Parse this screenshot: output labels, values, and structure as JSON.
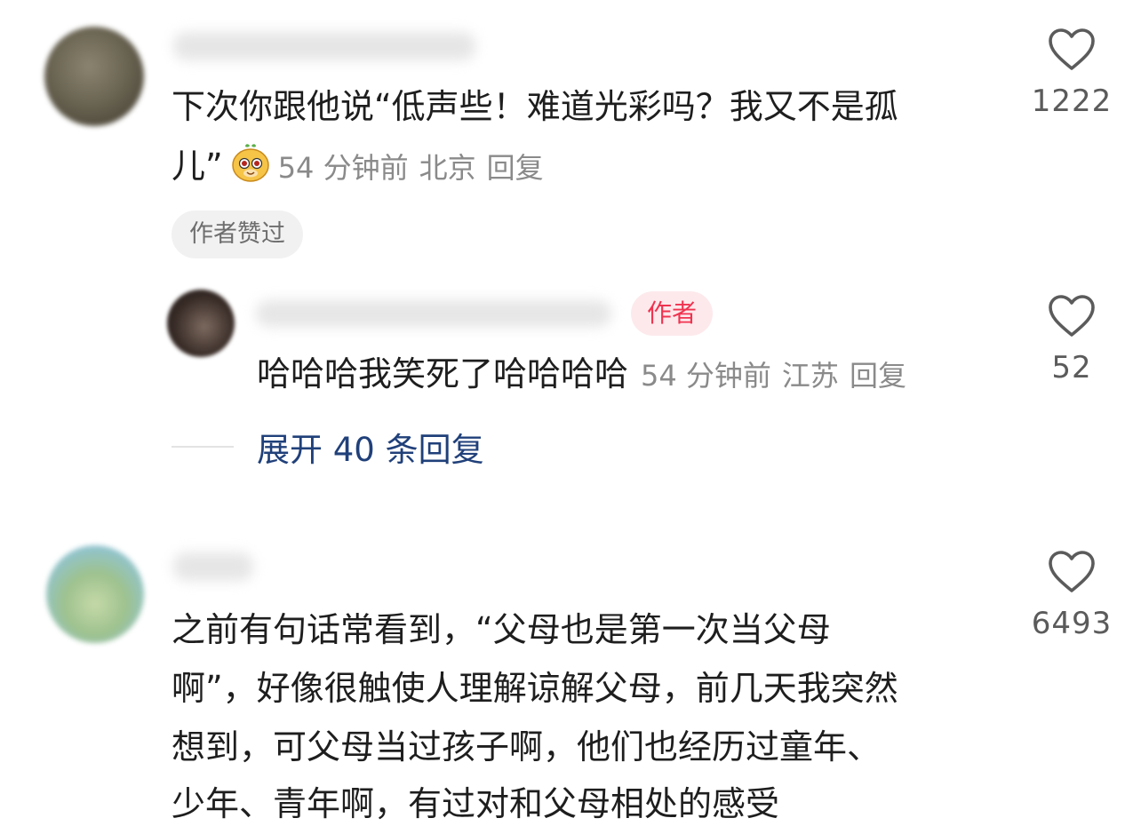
{
  "comments": [
    {
      "text_lines": [
        "下次你跟他说“低声些！难道光彩吗？我又不是孤",
        "儿”"
      ],
      "emoji": "doge-sticker",
      "time": "54 分钟前",
      "location": "北京",
      "reply_label": "回复",
      "badge": "作者赞过",
      "likes": "1222",
      "reply": {
        "author_tag": "作者",
        "text": "哈哈哈我笑死了哈哈哈哈",
        "time": "54 分钟前",
        "location": "江苏",
        "reply_label": "回复",
        "likes": "52"
      },
      "expand_label": "展开 40 条回复"
    },
    {
      "text_lines": [
        "之前有句话常看到，“父母也是第一次当父母",
        "啊”，好像很触使人理解谅解父母，前几天我突然",
        "想到，可父母当过孩子啊，他们也经历过童年、",
        "少年、青年啊，有过对和父母相处的感受"
      ],
      "likes": "6493"
    }
  ],
  "colors": {
    "author_tag_text": "#f0334f",
    "author_tag_bg": "#fde9ec",
    "expand_link": "#20407a",
    "meta_gray": "#8a8a8a"
  },
  "icons": [
    "heart-outline-icon"
  ]
}
